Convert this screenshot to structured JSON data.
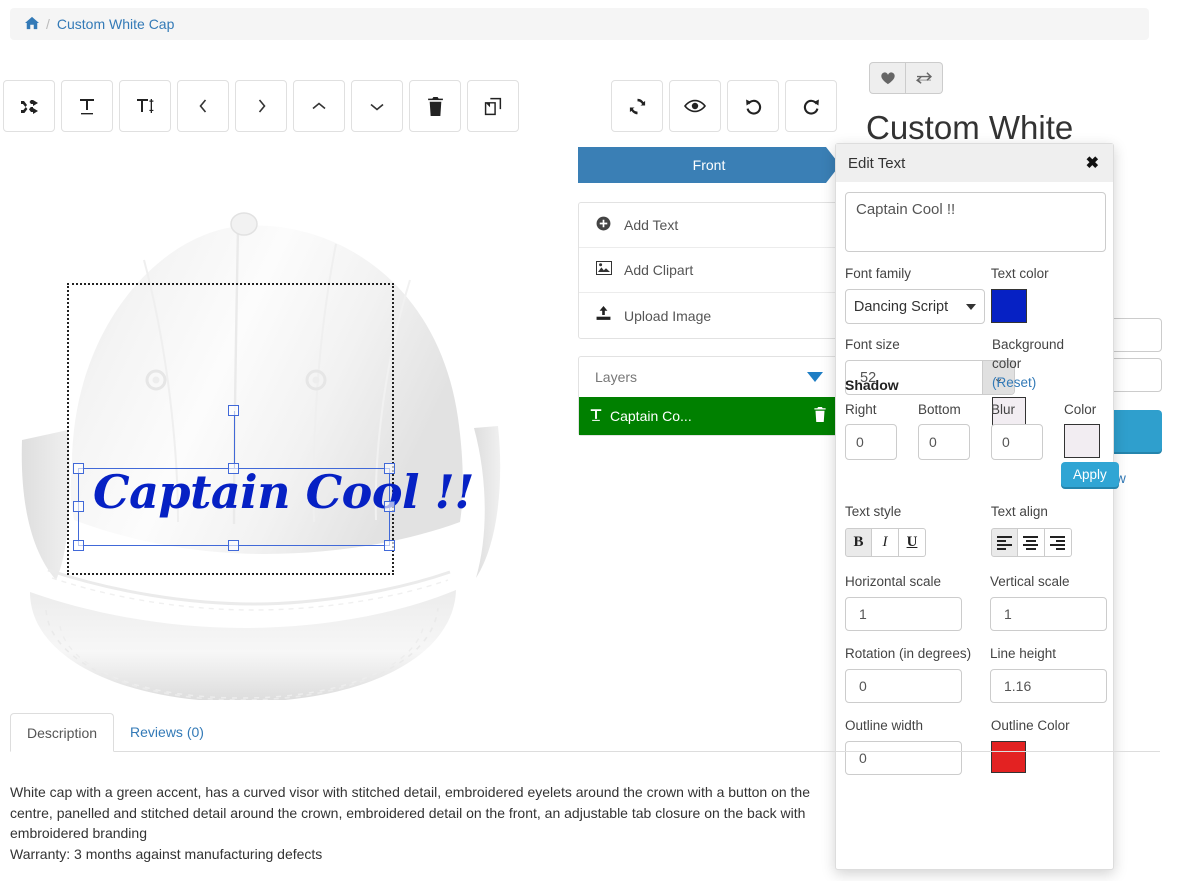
{
  "breadcrumb": {
    "home_icon": "home-icon",
    "separator": "/",
    "current": "Custom White Cap"
  },
  "design_toolbar": {
    "buttons": [
      {
        "name": "shuffle-layers",
        "glyph": "⤨"
      },
      {
        "name": "center-horizontally",
        "glyph": "ᴛ"
      },
      {
        "name": "center-vertically",
        "glyph": "T"
      },
      {
        "name": "move-left",
        "glyph": "‹"
      },
      {
        "name": "move-right",
        "glyph": "›"
      },
      {
        "name": "move-up",
        "glyph": "∧"
      },
      {
        "name": "move-down",
        "glyph": "∨"
      },
      {
        "name": "delete",
        "glyph": "🗑"
      },
      {
        "name": "duplicate",
        "glyph": "⧉"
      }
    ]
  },
  "canvas_toolbar": {
    "buttons": [
      {
        "name": "refresh",
        "glyph": "↻"
      },
      {
        "name": "preview",
        "glyph": "◉"
      },
      {
        "name": "undo",
        "glyph": "↶"
      },
      {
        "name": "redo",
        "glyph": "↷"
      }
    ]
  },
  "canvas": {
    "product_image": "white-baseball-cap",
    "design_text": "Captain Cool !!",
    "design_text_color": "#0621c4",
    "print_area_label": "print-area-boundary"
  },
  "side_tab": {
    "label": "Front"
  },
  "options": [
    {
      "name": "add-text",
      "icon": "plus-circle-icon",
      "glyph": "⊕",
      "label": "Add Text"
    },
    {
      "name": "add-clipart",
      "icon": "image-icon",
      "glyph": "ὛC",
      "label": "Add Clipart"
    },
    {
      "name": "upload-image",
      "icon": "upload-icon",
      "glyph": "⬆",
      "label": "Upload Image"
    }
  ],
  "layers": {
    "header": "Layers",
    "items": [
      {
        "label": "Captain Co...",
        "icon": "text-layer-icon",
        "delete_icon": "trash-icon",
        "selected": true,
        "color": "#008000"
      }
    ]
  },
  "product": {
    "title": "Custom White",
    "wishlist_icon": "heart-icon",
    "compare_icon": "compare-icon",
    "partial_link": "ew"
  },
  "edit_text_panel": {
    "title": "Edit Text",
    "close_icon": "close-icon",
    "textarea_value": "Captain Cool !!",
    "font_family": {
      "label": "Font family",
      "value": "Dancing Script"
    },
    "text_color": {
      "label": "Text color",
      "value": "#0621c4"
    },
    "font_size": {
      "label": "Font size",
      "value": "52"
    },
    "background_color": {
      "label_line1": "Background",
      "label_line2": "color",
      "reset": "(Reset)",
      "value": "#f2edf2"
    },
    "shadow": {
      "title": "Shadow",
      "right": {
        "label": "Right",
        "value": "0"
      },
      "bottom": {
        "label": "Bottom",
        "value": "0"
      },
      "blur": {
        "label": "Blur",
        "value": "0"
      },
      "color": {
        "label": "Color",
        "value": "#f2edf2"
      },
      "apply": "Apply"
    },
    "text_style": {
      "label": "Text style",
      "bold": {
        "glyph": "B",
        "active": true
      },
      "italic": {
        "glyph": "I",
        "active": false
      },
      "underline": {
        "glyph": "U",
        "active": false
      }
    },
    "text_align": {
      "label": "Text align",
      "options": [
        {
          "name": "align-left",
          "active": true
        },
        {
          "name": "align-center",
          "active": false
        },
        {
          "name": "align-right",
          "active": false
        }
      ]
    },
    "horizontal_scale": {
      "label": "Horizontal scale",
      "value": "1"
    },
    "vertical_scale": {
      "label": "Vertical scale",
      "value": "1"
    },
    "rotation": {
      "label": "Rotation (in degrees)",
      "value": "0"
    },
    "line_height": {
      "label": "Line height",
      "value": "1.16"
    },
    "outline_width": {
      "label": "Outline width",
      "value": "0"
    },
    "outline_color": {
      "label": "Outline Color",
      "value": "#e32222"
    }
  },
  "tabs": [
    {
      "label": "Description",
      "active": true
    },
    {
      "label": "Reviews (0)",
      "active": false
    }
  ],
  "description": {
    "paragraph": "White cap with a green accent, has a curved visor with stitched detail, embroidered eyelets around the crown with a button on the centre, panelled and stitched detail around the crown, embroidered detail on the front, an adjustable tab closure on the back with embroidered branding",
    "warranty": "Warranty: 3 months against manufacturing defects"
  }
}
